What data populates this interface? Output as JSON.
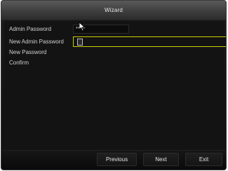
{
  "window": {
    "title": "Wizard"
  },
  "form": {
    "admin_password_label": "Admin Password",
    "admin_password_value": "*****",
    "new_admin_password_label": "New Admin Password",
    "new_password_label": "New Password",
    "confirm_label": "Confirm"
  },
  "footer": {
    "previous_label": "Previous",
    "next_label": "Next",
    "exit_label": "Exit"
  },
  "colors": {
    "focus_border": "#c9d000",
    "window_bg": "#131313"
  },
  "icons": {
    "pointer": "mouse-pointer-icon"
  }
}
